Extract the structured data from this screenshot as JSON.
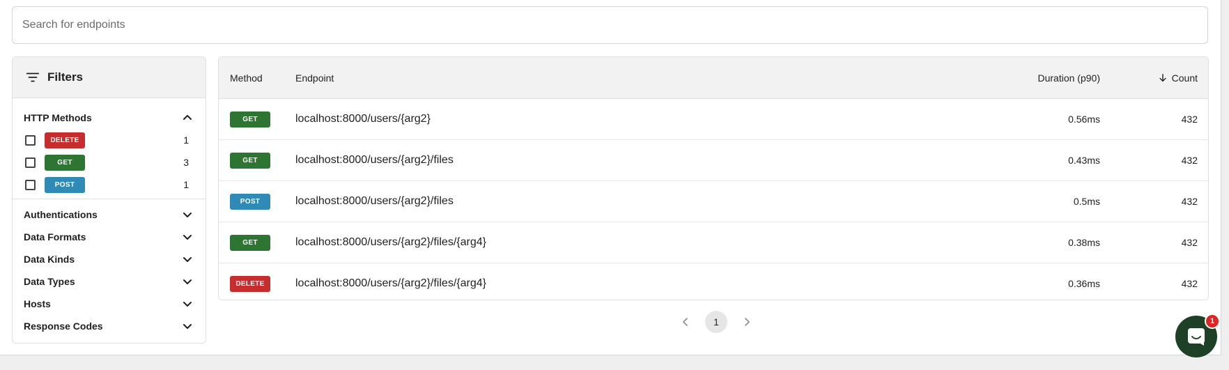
{
  "search": {
    "placeholder": "Search for endpoints",
    "value": ""
  },
  "filters": {
    "title": "Filters",
    "http_methods": {
      "label": "HTTP Methods",
      "items": [
        {
          "method": "DELETE",
          "count": "1",
          "color": "#c62d2d"
        },
        {
          "method": "GET",
          "count": "3",
          "color": "#2e7533"
        },
        {
          "method": "POST",
          "count": "1",
          "color": "#2f8ab6"
        }
      ]
    },
    "groups": [
      {
        "label": "Authentications"
      },
      {
        "label": "Data Formats"
      },
      {
        "label": "Data Kinds"
      },
      {
        "label": "Data Types"
      },
      {
        "label": "Hosts"
      },
      {
        "label": "Response Codes"
      }
    ]
  },
  "table": {
    "headers": {
      "method": "Method",
      "endpoint": "Endpoint",
      "duration": "Duration (p90)",
      "count": "Count"
    },
    "rows": [
      {
        "method": "GET",
        "endpoint": "localhost:8000/users/{arg2}",
        "duration": "0.56ms",
        "count": "432"
      },
      {
        "method": "GET",
        "endpoint": "localhost:8000/users/{arg2}/files",
        "duration": "0.43ms",
        "count": "432"
      },
      {
        "method": "POST",
        "endpoint": "localhost:8000/users/{arg2}/files",
        "duration": "0.5ms",
        "count": "432"
      },
      {
        "method": "GET",
        "endpoint": "localhost:8000/users/{arg2}/files/{arg4}",
        "duration": "0.38ms",
        "count": "432"
      },
      {
        "method": "DELETE",
        "endpoint": "localhost:8000/users/{arg2}/files/{arg4}",
        "duration": "0.36ms",
        "count": "432"
      }
    ]
  },
  "pagination": {
    "current_page": "1"
  },
  "chat": {
    "unread": "1"
  },
  "colors": {
    "get": "#2e7533",
    "post": "#2f8ab6",
    "delete": "#c62d2d",
    "chat": "#1d4026"
  }
}
